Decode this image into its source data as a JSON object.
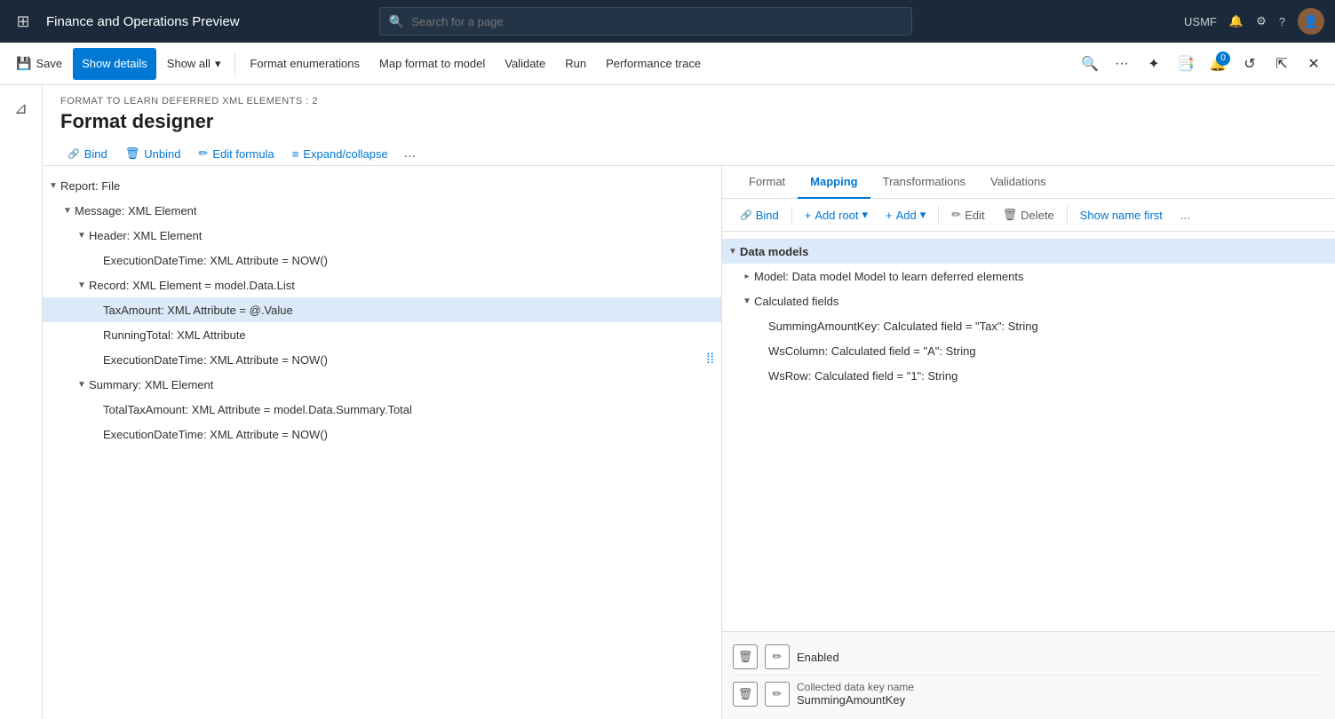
{
  "app": {
    "title": "Finance and Operations Preview",
    "search_placeholder": "Search for a page",
    "user": "USMF"
  },
  "topbar_toolbar": {
    "save_label": "Save",
    "show_details_label": "Show details",
    "show_all_label": "Show all",
    "format_enumerations_label": "Format enumerations",
    "map_format_label": "Map format to model",
    "validate_label": "Validate",
    "run_label": "Run",
    "performance_trace_label": "Performance trace"
  },
  "page": {
    "breadcrumb": "FORMAT TO LEARN DEFERRED XML ELEMENTS : 2",
    "title": "Format designer"
  },
  "format_toolbar": {
    "bind_label": "Bind",
    "unbind_label": "Unbind",
    "edit_formula_label": "Edit formula",
    "expand_collapse_label": "Expand/collapse",
    "more_label": "..."
  },
  "format_tree": {
    "items": [
      {
        "indent": 0,
        "expander": "▼",
        "label": "Report: File",
        "type": "normal"
      },
      {
        "indent": 1,
        "expander": "▼",
        "label": "Message: XML Element",
        "type": "normal"
      },
      {
        "indent": 2,
        "expander": "▼",
        "label": "Header: XML Element",
        "type": "normal"
      },
      {
        "indent": 3,
        "expander": "",
        "label": "ExecutionDateTime: XML Attribute = NOW()",
        "type": "normal"
      },
      {
        "indent": 2,
        "expander": "▼",
        "label": "Record: XML Element = model.Data.List",
        "type": "normal"
      },
      {
        "indent": 3,
        "expander": "",
        "label": "TaxAmount: XML Attribute = @.Value",
        "type": "selected"
      },
      {
        "indent": 3,
        "expander": "",
        "label": "RunningTotal: XML Attribute",
        "type": "normal"
      },
      {
        "indent": 3,
        "expander": "",
        "label": "ExecutionDateTime: XML Attribute = NOW()",
        "type": "normal"
      },
      {
        "indent": 2,
        "expander": "▼",
        "label": "Summary: XML Element",
        "type": "normal"
      },
      {
        "indent": 3,
        "expander": "",
        "label": "TotalTaxAmount: XML Attribute = model.Data.Summary.Total",
        "type": "normal"
      },
      {
        "indent": 3,
        "expander": "",
        "label": "ExecutionDateTime: XML Attribute = NOW()",
        "type": "normal"
      }
    ]
  },
  "mapping_tabs": {
    "tabs": [
      {
        "id": "format",
        "label": "Format"
      },
      {
        "id": "mapping",
        "label": "Mapping",
        "active": true
      },
      {
        "id": "transformations",
        "label": "Transformations"
      },
      {
        "id": "validations",
        "label": "Validations"
      }
    ]
  },
  "mapping_toolbar": {
    "bind_label": "Bind",
    "add_root_label": "Add root",
    "add_label": "Add",
    "edit_label": "Edit",
    "delete_label": "Delete",
    "show_name_first_label": "Show name first",
    "more_label": "..."
  },
  "mapping_tree": {
    "items": [
      {
        "indent": 0,
        "expander": "▼",
        "label": "Data models",
        "type": "selected_header"
      },
      {
        "indent": 1,
        "expander": "▸",
        "label": "Model: Data model Model to learn deferred elements",
        "type": "normal"
      },
      {
        "indent": 1,
        "expander": "▼",
        "label": "Calculated fields",
        "type": "normal"
      },
      {
        "indent": 2,
        "expander": "",
        "label": "SummingAmountKey: Calculated field = \"Tax\": String",
        "type": "normal"
      },
      {
        "indent": 2,
        "expander": "",
        "label": "WsColumn: Calculated field = \"A\": String",
        "type": "normal"
      },
      {
        "indent": 2,
        "expander": "",
        "label": "WsRow: Calculated field = \"1\": String",
        "type": "normal"
      }
    ]
  },
  "mapping_bottom": {
    "row1": {
      "label": "Enabled",
      "delete_icon": "🗑",
      "edit_icon": "✏"
    },
    "row2": {
      "label": "Collected data key name",
      "value": "SummingAmountKey",
      "delete_icon": "🗑",
      "edit_icon": "✏"
    }
  },
  "sidebar_icons": [
    {
      "id": "menu",
      "icon": "☰",
      "label": "menu-icon"
    },
    {
      "id": "home",
      "icon": "⌂",
      "label": "home-icon"
    },
    {
      "id": "star",
      "icon": "☆",
      "label": "favorites-icon"
    },
    {
      "id": "recent",
      "icon": "◷",
      "label": "recent-icon"
    },
    {
      "id": "workspaces",
      "icon": "⊞",
      "label": "workspaces-icon"
    },
    {
      "id": "list",
      "icon": "☰",
      "label": "list-icon"
    }
  ]
}
